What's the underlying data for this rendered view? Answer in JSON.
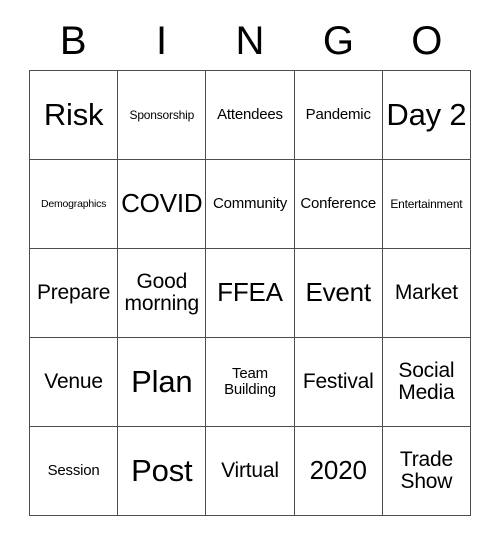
{
  "card": {
    "header_letters": [
      "B",
      "I",
      "N",
      "G",
      "O"
    ],
    "rows": [
      [
        {
          "text": "Risk",
          "size": "s-xl"
        },
        {
          "text": "Sponsorship",
          "size": "s-xs"
        },
        {
          "text": "Attendees",
          "size": "s-sm"
        },
        {
          "text": "Pandemic",
          "size": "s-sm"
        },
        {
          "text": "Day 2",
          "size": "s-xl"
        }
      ],
      [
        {
          "text": "Demographics",
          "size": "s-xxs"
        },
        {
          "text": "COVID",
          "size": "s-lg"
        },
        {
          "text": "Community",
          "size": "s-sm"
        },
        {
          "text": "Conference",
          "size": "s-sm"
        },
        {
          "text": "Entertainment",
          "size": "s-xs"
        }
      ],
      [
        {
          "text": "Prepare",
          "size": "s-md"
        },
        {
          "text": "Good morning",
          "size": "s-md"
        },
        {
          "text": "FFEA",
          "size": "s-lg"
        },
        {
          "text": "Event",
          "size": "s-lg"
        },
        {
          "text": "Market",
          "size": "s-md"
        }
      ],
      [
        {
          "text": "Venue",
          "size": "s-md"
        },
        {
          "text": "Plan",
          "size": "s-xl"
        },
        {
          "text": "Team Building",
          "size": "s-sm"
        },
        {
          "text": "Festival",
          "size": "s-md"
        },
        {
          "text": "Social Media",
          "size": "s-md"
        }
      ],
      [
        {
          "text": "Session",
          "size": "s-sm"
        },
        {
          "text": "Post",
          "size": "s-xl"
        },
        {
          "text": "Virtual",
          "size": "s-md"
        },
        {
          "text": "2020",
          "size": "s-lg"
        },
        {
          "text": "Trade Show",
          "size": "s-md"
        }
      ]
    ]
  },
  "colors": {
    "border": "#4d4d4d",
    "text": "#000000",
    "cell_background": "#ffffff",
    "page_background": "#ffffff"
  }
}
